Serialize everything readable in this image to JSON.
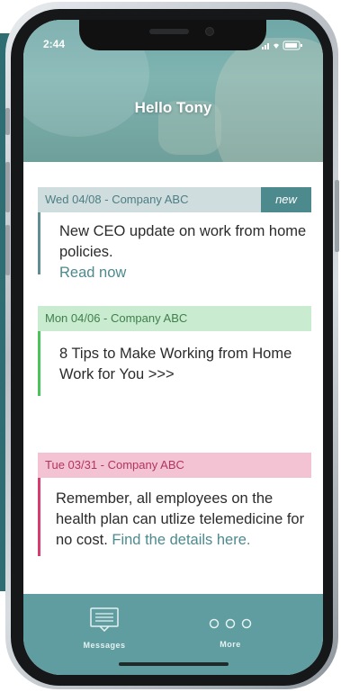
{
  "status_bar": {
    "time": "2:44",
    "icons": "signal wifi battery"
  },
  "header": {
    "greeting": "Hello Tony"
  },
  "cards": [
    {
      "date": "Wed 04/08 - Company ABC",
      "badge": "new",
      "text": "New CEO update on work from home policies.",
      "link": "Read now",
      "accent": "#5f8f93",
      "head_bg": "#cfdddf",
      "head_color": "#4d7e82"
    },
    {
      "date": "Mon 04/06 - Company ABC",
      "text": "8 Tips to Make Working from Home Work for You >>>",
      "accent": "#4cc35a",
      "head_bg": "#c9ecd0",
      "head_color": "#3f7f4b"
    },
    {
      "date": "Tue 03/31 - Company ABC",
      "text": "Remember, all employees on the health plan can utlize telemedicine for no cost.",
      "link": "Find the details here.",
      "accent": "#d93b73",
      "head_bg": "#f3c3d4",
      "head_color": "#b1355f"
    }
  ],
  "tab_bar": {
    "messages_label": "Messages",
    "more_label": "More",
    "messages_icon": "message-icon",
    "more_icon": "more-dots-icon"
  },
  "colors": {
    "tab_bar": "#5f9da0",
    "hero": "#7fb4b1",
    "side_panel": "#2e6d72"
  }
}
